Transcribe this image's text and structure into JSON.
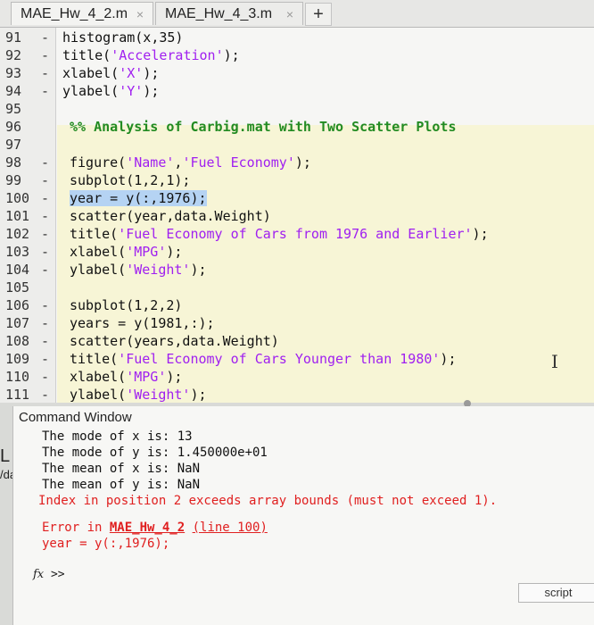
{
  "tabs": [
    {
      "label": "MAE_Hw_4_2.m",
      "close": "×"
    },
    {
      "label": "MAE_Hw_4_3.m",
      "close": "×"
    }
  ],
  "new_tab": "+",
  "editor": {
    "lines": [
      {
        "num": "91",
        "dash": "-",
        "code": "histogram(x,35)"
      },
      {
        "num": "92",
        "dash": "-",
        "code": "title('Acceleration');"
      },
      {
        "num": "93",
        "dash": "-",
        "code": "xlabel('X');"
      },
      {
        "num": "94",
        "dash": "-",
        "code": "ylabel('Y');"
      },
      {
        "num": "95",
        "dash": "",
        "code": ""
      },
      {
        "num": "96",
        "dash": "",
        "code": "%% Analysis of Carbig.mat with Two Scatter Plots"
      },
      {
        "num": "97",
        "dash": "",
        "code": ""
      },
      {
        "num": "98",
        "dash": "-",
        "code": "figure('Name','Fuel Economy');"
      },
      {
        "num": "99",
        "dash": "-",
        "code": "subplot(1,2,1);"
      },
      {
        "num": "100",
        "dash": "-",
        "code": "year = y(:,1976);"
      },
      {
        "num": "101",
        "dash": "-",
        "code": "scatter(year,data.Weight)"
      },
      {
        "num": "102",
        "dash": "-",
        "code": "title('Fuel Economy of Cars from 1976 and Earlier');"
      },
      {
        "num": "103",
        "dash": "-",
        "code": "xlabel('MPG');"
      },
      {
        "num": "104",
        "dash": "-",
        "code": "ylabel('Weight');"
      },
      {
        "num": "105",
        "dash": "",
        "code": ""
      },
      {
        "num": "106",
        "dash": "-",
        "code": "subplot(1,2,2)"
      },
      {
        "num": "107",
        "dash": "-",
        "code": "years = y(1981,:);"
      },
      {
        "num": "108",
        "dash": "-",
        "code": "scatter(years,data.Weight)"
      },
      {
        "num": "109",
        "dash": "-",
        "code": "title('Fuel Economy of Cars Younger than 1980');"
      },
      {
        "num": "110",
        "dash": "-",
        "code": "xlabel('MPG');"
      },
      {
        "num": "111",
        "dash": "-",
        "code": "ylabel('Weight');"
      }
    ]
  },
  "command_window": {
    "title": "Command Window",
    "output": [
      "The mode of x is: 13",
      "The mode of y is: 1.450000e+01",
      "The mean of x is: NaN",
      "The mean of y is: NaN"
    ],
    "error_message": "Index in position 2 exceeds array bounds (must not exceed 1).",
    "error_prefix": "Error in ",
    "error_file": "MAE_Hw_4_2",
    "error_line_link": "(line 100)",
    "error_code": "year = y(:,1976);",
    "prompt_fx": "fx",
    "prompt": ">>",
    "script_button": "script"
  },
  "left_fragments": [
    "L",
    "/da"
  ],
  "colors": {
    "string": "#a020f0",
    "comment": "#228b22",
    "error": "#e02020",
    "selection": "#b5d3f3",
    "cell_highlight": "#f7f5d6"
  }
}
